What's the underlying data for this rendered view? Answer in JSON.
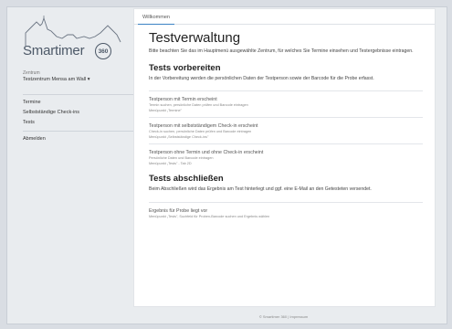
{
  "app": {
    "logo_text": "Smartimer",
    "logo_badge": "360"
  },
  "sidebar": {
    "zentrum_label": "Zentrum",
    "zentrum_value": "Testzentrum Mensa am Wall",
    "items": [
      {
        "label": "Termine"
      },
      {
        "label": "Selbstständige Check-ins"
      },
      {
        "label": "Tests"
      }
    ],
    "logout_label": "Abmelden"
  },
  "tabs": [
    {
      "label": "Willkommen"
    }
  ],
  "main": {
    "title": "Testverwaltung",
    "intro": "Bitte beachten Sie das im Hauptmenü ausgewählte Zentrum, für welches Sie Termine einsehen und Testergebnisse eintragen.",
    "section1": {
      "title": "Tests vorbereiten",
      "text": "In der Vorbereitung werden die persönlichen Daten der Testperson sowie der Barcode für die Probe erfasst.",
      "items": [
        {
          "title": "Testperson mit Termin erscheint",
          "line1": "Termin suchen, persönliche Daten prüfen und Barcode eintragen",
          "line2": "Menüpunkt „Termine\""
        },
        {
          "title": "Testperson mit selbstständigem Check-in erscheint",
          "line1": "Check-in suchen, persönliche Daten prüfen und Barcode eintragen",
          "line2": "Menüpunkt „Selbstständige Check-ins\""
        },
        {
          "title": "Testperson ohne Termin und ohne Check-in erscheint",
          "line1": "Persönliche Daten und Barcode eintragen",
          "line2": "Menüpunkt „Tests\" - Tab 2D"
        }
      ]
    },
    "section2": {
      "title": "Tests abschließen",
      "text": "Beim Abschließen wird das Ergebnis am Test hinterlegt und ggf. eine E-Mail an den Getesteten versendet.",
      "items": [
        {
          "title": "Ergebnis für Probe liegt vor",
          "line1": "Menüpunkt „Tests\", Suchfeld für Proben-Barcode suchen und Ergebnis wählen"
        }
      ]
    }
  },
  "footer": {
    "text": "© Smartimer 360 | Impressum"
  },
  "colors": {
    "accent": "#3b82c4",
    "background": "#e9ecef",
    "card": "#ffffff"
  }
}
